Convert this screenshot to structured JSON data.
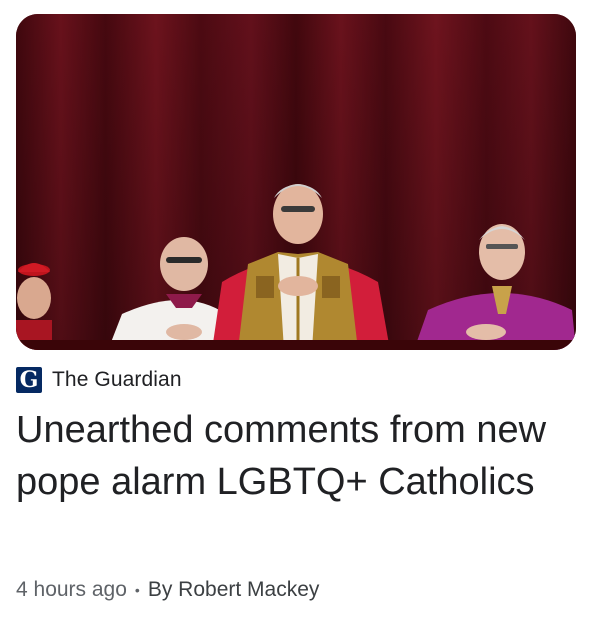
{
  "article": {
    "source": {
      "logo_letter": "G",
      "name": "The Guardian"
    },
    "headline": "Unearthed comments from new pope alarm LGBTQ+ Catholics",
    "time_ago": "4 hours ago",
    "separator": "•",
    "byline": "By Robert Mackey"
  },
  "colors": {
    "curtain": "#6b0f1a",
    "logo_bg": "#052962",
    "headline_text": "#202124",
    "meta_text": "#5f6368"
  }
}
